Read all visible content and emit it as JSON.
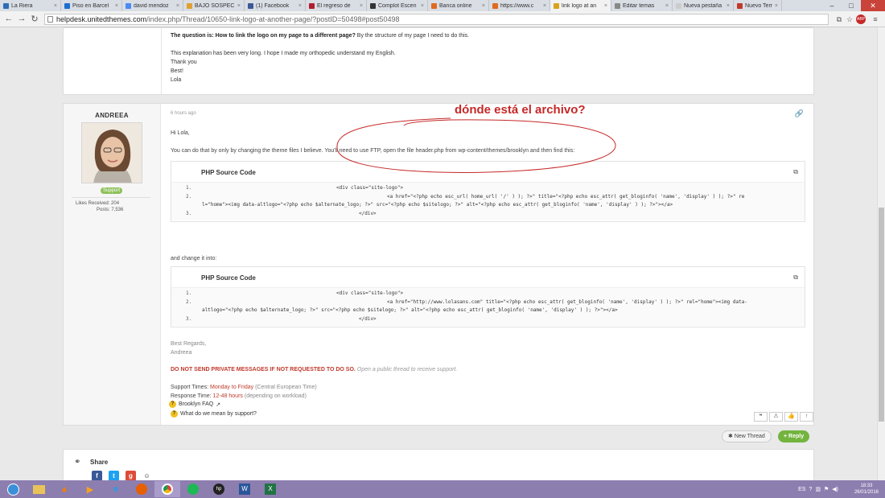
{
  "browser": {
    "tabs": [
      {
        "label": "La Riera",
        "color": "#2d6cb5",
        "active": false
      },
      {
        "label": "Piso en Barcel",
        "color": "#1b6fd0",
        "active": false
      },
      {
        "label": "david mendoz",
        "color": "#4a8af4",
        "active": false
      },
      {
        "label": "BAJO SOSPEC",
        "color": "#e0a030",
        "active": false
      },
      {
        "label": "(1) Facebook",
        "color": "#3b5998",
        "active": false
      },
      {
        "label": "El regreso de",
        "color": "#b01e2e",
        "active": false
      },
      {
        "label": "Complot Escen",
        "color": "#333333",
        "active": false
      },
      {
        "label": "Banca online",
        "color": "#e06a20",
        "active": false
      },
      {
        "label": "https://www.c",
        "color": "#e06a20",
        "active": false
      },
      {
        "label": "link logo at an",
        "color": "#d9a21b",
        "active": true
      },
      {
        "label": "Editar temas",
        "color": "#888888",
        "active": false
      },
      {
        "label": "Nueva pestaña",
        "color": "#cccccc",
        "active": false
      },
      {
        "label": "Nuevo Tema",
        "color": "#c0392b",
        "active": false
      }
    ],
    "url_host": "helpdesk.unitedthemes.com",
    "url_path": "/index.php/Thread/10650-link-logo-at-another-page/?postID=50498#post50498"
  },
  "post1": {
    "question_bold": "The question is: How to link the logo on my page to a different page?",
    "question_rest": " By the structure of my page I need to do this.",
    "line2": "This explanation has been very long. I hope I made my orthopedic understand my English.",
    "line3": "Thank you",
    "line4": "Best!",
    "line5": "Lola"
  },
  "post2": {
    "username": "ANDREEA",
    "badge": "Support",
    "likes": "Likes Received: 204",
    "posts": "Posts: 7,536",
    "timestamp": "6 hours ago",
    "greeting": "Hi Lola,",
    "intro": "You can do that by only by changing the theme files I believe. You'll need to use FTP, open the file header.php from wp-content/themes/brooklyn and then find this:",
    "code1": {
      "title": "PHP Source Code",
      "line1": "<div class=\"site-logo\">",
      "line2a": "<a href=\"<?php echo esc_url( home_url( '/' ) ); ?>\" title=\"<?php echo esc_attr( get_bloginfo( 'name', 'display' ) ); ?>\" re",
      "line2b": "l=\"home\"><img data-altlogo=\"<?php echo $alternate_logo; ?>\" src=\"<?php echo $sitelogo; ?>\" alt=\"<?php echo esc_attr( get_bloginfo( 'name', 'display' ) ); ?>\"></a>",
      "line3": "</div>"
    },
    "change_text": "and change it into:",
    "code2": {
      "title": "PHP Source Code",
      "line1": "<div class=\"site-logo\">",
      "line2a": "<a href=\"http://www.lolasans.com\" title=\"<?php echo esc_attr( get_bloginfo( 'name', 'display' ) ); ?>\" rel=\"home\"><img data-",
      "line2b": "altlogo=\"<?php echo $alternate_logo; ?>\" src=\"<?php echo $sitelogo; ?>\" alt=\"<?php echo esc_attr( get_bloginfo( 'name', 'display' ) ); ?>\"></a>",
      "line3": "</div>"
    },
    "regards1": "Best Regards,",
    "regards2": "Andreea",
    "warning_red": "DO NOT SEND PRIVATE MESSAGES IF NOT REQUESTED TO DO SO.",
    "warning_rest": " Open a public thread to receive support.",
    "support_label": "Support Times:",
    "support_days": "Monday to Friday",
    "support_tz": "(Central European Time)",
    "response_label": "Response Time:",
    "response_hours": "12-48 hours",
    "response_note": "(depending on workload)",
    "faq1": "What do we mean by support?",
    "faq2": "Brooklyn FAQ"
  },
  "annotation": "dónde está el archivo?",
  "buttons": {
    "new_thread": "New Thread",
    "reply": "Reply"
  },
  "share": {
    "title": "Share"
  },
  "taskbar": {
    "lang": "ES",
    "time": "18:33",
    "date": "26/01/2016"
  }
}
